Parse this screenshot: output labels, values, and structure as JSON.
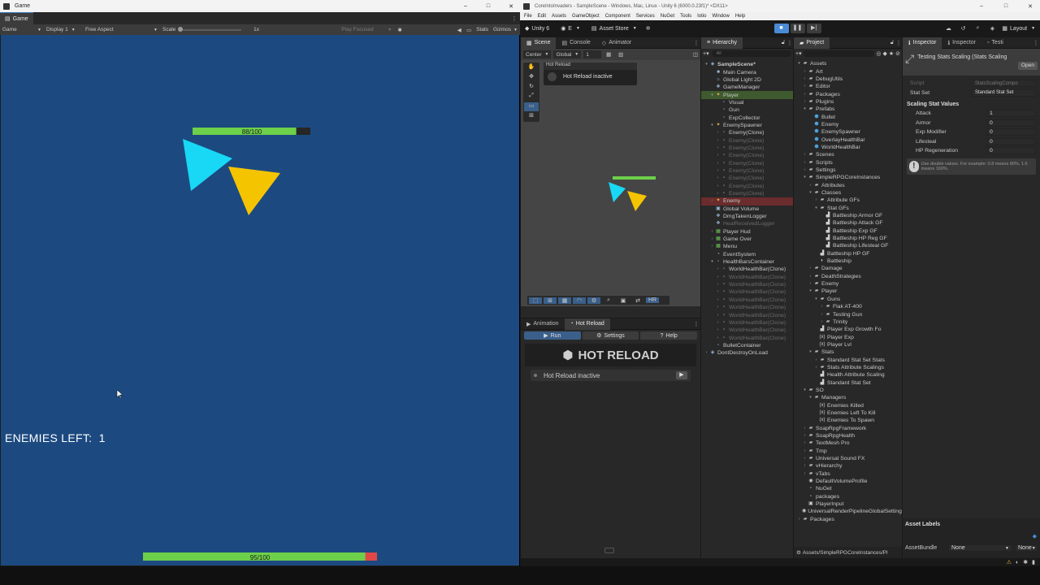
{
  "game_window": {
    "title": "Game",
    "tab": "Game",
    "toolbar": {
      "view": "Game",
      "display": "Display 1",
      "aspect": "Free Aspect",
      "scale_label": "Scale",
      "scale_value": "1x",
      "play_mode": "Play Focused",
      "stats": "Stats",
      "gizmos": "Gizmos"
    },
    "top_health_bar": {
      "text": "88/100",
      "fill": 0.88
    },
    "bottom_health_bar": {
      "text": "95/100",
      "fill": 0.95
    },
    "enemies_left_label": "ENEMIES LEFT:",
    "enemies_left_value": "1",
    "colors": {
      "bg": "#1c4a80",
      "cyan": "#18d8f5",
      "yellow": "#f5c400",
      "green": "#6dd04a",
      "red": "#e04848"
    }
  },
  "editor": {
    "title": "CoreIntoInvaders - SampleScene - Windows, Mac, Linux - Unity 6 (6000.0.23f1)* <DX11>",
    "menu": [
      "File",
      "Edit",
      "Assets",
      "GameObject",
      "Component",
      "Services",
      "NuGet",
      "Tools",
      "Iotio",
      "Window",
      "Help"
    ],
    "toolbar": {
      "unity": "Unity 6",
      "account": "E",
      "asset_store": "Asset Store",
      "layout": "Layout"
    },
    "scene_tabs": [
      "Scene",
      "Console",
      "Animator"
    ],
    "scene_toolbar": {
      "pivot": "Center",
      "space": "Global",
      "snap": "1"
    },
    "hot_reload_overlay": {
      "title": "Hot Reload",
      "status": "Hot Reload inactive"
    },
    "bottom_tabs": [
      "Animation",
      "Hot Reload"
    ],
    "hot_reload_panel": {
      "run": "Run",
      "settings": "Settings",
      "help": "Help",
      "logo": "HOT RELOAD",
      "status": "Hot Reload inactive"
    },
    "hierarchy": {
      "tab": "Hierarchy",
      "search_placeholder": "All",
      "items": [
        {
          "label": "SampleScene*",
          "indent": 0,
          "tri": "▾",
          "icon": "◈",
          "style": "bold"
        },
        {
          "label": "Main Camera",
          "indent": 1,
          "tri": "",
          "icon": "■",
          "style": ""
        },
        {
          "label": "Global Light 2D",
          "indent": 1,
          "tri": "",
          "icon": "☼",
          "style": ""
        },
        {
          "label": "GameManager",
          "indent": 1,
          "tri": "",
          "icon": "❖",
          "style": ""
        },
        {
          "label": "Player",
          "indent": 1,
          "tri": "▾",
          "icon": "✦",
          "style": "selg"
        },
        {
          "label": "Visual",
          "indent": 2,
          "tri": "",
          "icon": "▫",
          "style": ""
        },
        {
          "label": "Gun",
          "indent": 2,
          "tri": "",
          "icon": "▫",
          "style": ""
        },
        {
          "label": "ExpCollector",
          "indent": 2,
          "tri": "",
          "icon": "▫",
          "style": ""
        },
        {
          "label": "EnemySpawner",
          "indent": 1,
          "tri": "▾",
          "icon": "✦",
          "style": ""
        },
        {
          "label": "Enemy(Clone)",
          "indent": 2,
          "tri": "›",
          "icon": "▫",
          "style": ""
        },
        {
          "label": "Enemy(Clone)",
          "indent": 2,
          "tri": "›",
          "icon": "▫",
          "style": "dim"
        },
        {
          "label": "Enemy(Clone)",
          "indent": 2,
          "tri": "›",
          "icon": "▫",
          "style": "dim"
        },
        {
          "label": "Enemy(Clone)",
          "indent": 2,
          "tri": "›",
          "icon": "▫",
          "style": "dim"
        },
        {
          "label": "Enemy(Clone)",
          "indent": 2,
          "tri": "›",
          "icon": "▫",
          "style": "dim"
        },
        {
          "label": "Enemy(Clone)",
          "indent": 2,
          "tri": "›",
          "icon": "▫",
          "style": "dim"
        },
        {
          "label": "Enemy(Clone)",
          "indent": 2,
          "tri": "›",
          "icon": "▫",
          "style": "dim"
        },
        {
          "label": "Enemy(Clone)",
          "indent": 2,
          "tri": "›",
          "icon": "▫",
          "style": "dim"
        },
        {
          "label": "Enemy(Clone)",
          "indent": 2,
          "tri": "›",
          "icon": "▫",
          "style": "dim"
        },
        {
          "label": "Enemy",
          "indent": 1,
          "tri": "›",
          "icon": "✦",
          "style": "selr"
        },
        {
          "label": "Global Volume",
          "indent": 1,
          "tri": "",
          "icon": "▣",
          "style": ""
        },
        {
          "label": "DmgTakenLogger",
          "indent": 1,
          "tri": "",
          "icon": "❖",
          "style": ""
        },
        {
          "label": "HealReceivedLogger",
          "indent": 1,
          "tri": "",
          "icon": "❖",
          "style": "dim"
        },
        {
          "label": "Player Hud",
          "indent": 1,
          "tri": "›",
          "icon": "▦",
          "style": ""
        },
        {
          "label": "Game Over",
          "indent": 1,
          "tri": "›",
          "icon": "▦",
          "style": ""
        },
        {
          "label": "Menu",
          "indent": 1,
          "tri": "›",
          "icon": "▦",
          "style": ""
        },
        {
          "label": "EventSystem",
          "indent": 1,
          "tri": "",
          "icon": "◔",
          "style": ""
        },
        {
          "label": "HealthBarsContainer",
          "indent": 1,
          "tri": "▾",
          "icon": "▫",
          "style": ""
        },
        {
          "label": "WorldHealthBar(Clone)",
          "indent": 2,
          "tri": "›",
          "icon": "▫",
          "style": ""
        },
        {
          "label": "WorldHealthBar(Clone)",
          "indent": 2,
          "tri": "›",
          "icon": "▫",
          "style": "dim"
        },
        {
          "label": "WorldHealthBar(Clone)",
          "indent": 2,
          "tri": "›",
          "icon": "▫",
          "style": "dim"
        },
        {
          "label": "WorldHealthBar(Clone)",
          "indent": 2,
          "tri": "›",
          "icon": "▫",
          "style": "dim"
        },
        {
          "label": "WorldHealthBar(Clone)",
          "indent": 2,
          "tri": "›",
          "icon": "▫",
          "style": "dim"
        },
        {
          "label": "WorldHealthBar(Clone)",
          "indent": 2,
          "tri": "›",
          "icon": "▫",
          "style": "dim"
        },
        {
          "label": "WorldHealthBar(Clone)",
          "indent": 2,
          "tri": "›",
          "icon": "▫",
          "style": "dim"
        },
        {
          "label": "WorldHealthBar(Clone)",
          "indent": 2,
          "tri": "›",
          "icon": "▫",
          "style": "dim"
        },
        {
          "label": "WorldHealthBar(Clone)",
          "indent": 2,
          "tri": "›",
          "icon": "▫",
          "style": "dim"
        },
        {
          "label": "WorldHealthBar(Clone)",
          "indent": 2,
          "tri": "›",
          "icon": "▫",
          "style": "dim"
        },
        {
          "label": "BulletContainer",
          "indent": 1,
          "tri": "",
          "icon": "▫",
          "style": ""
        },
        {
          "label": "DontDestroyOnLoad",
          "indent": 0,
          "tri": "›",
          "icon": "◈",
          "style": ""
        }
      ]
    },
    "project": {
      "tab": "Project",
      "footer_path": "Assets/SimpleRPGCoreInstances/Pl",
      "items": [
        {
          "label": "Assets",
          "indent": 0,
          "tri": "▾",
          "icon": "▰"
        },
        {
          "label": "Art",
          "indent": 1,
          "tri": "›",
          "icon": "▰"
        },
        {
          "label": "DebugUtils",
          "indent": 1,
          "tri": "›",
          "icon": "▰"
        },
        {
          "label": "Editor",
          "indent": 1,
          "tri": "›",
          "icon": "▰"
        },
        {
          "label": "Packages",
          "indent": 1,
          "tri": "›",
          "icon": "▰"
        },
        {
          "label": "Plugins",
          "indent": 1,
          "tri": "›",
          "icon": "▰"
        },
        {
          "label": "Prefabs",
          "indent": 1,
          "tri": "▾",
          "icon": "▰"
        },
        {
          "label": "Bullet",
          "indent": 2,
          "tri": "",
          "icon": "⬢"
        },
        {
          "label": "Enemy",
          "indent": 2,
          "tri": "",
          "icon": "⬢"
        },
        {
          "label": "EnemySpawner",
          "indent": 2,
          "tri": "",
          "icon": "⬢"
        },
        {
          "label": "OverlayHealthBar",
          "indent": 2,
          "tri": "",
          "icon": "⬢"
        },
        {
          "label": "WorldHealthBar",
          "indent": 2,
          "tri": "",
          "icon": "⬢"
        },
        {
          "label": "Scenes",
          "indent": 1,
          "tri": "›",
          "icon": "▰"
        },
        {
          "label": "Scripts",
          "indent": 1,
          "tri": "›",
          "icon": "▰"
        },
        {
          "label": "Settings",
          "indent": 1,
          "tri": "›",
          "icon": "▰"
        },
        {
          "label": "SimpleRPGCoreInstances",
          "indent": 1,
          "tri": "▾",
          "icon": "▰"
        },
        {
          "label": "Attributes",
          "indent": 2,
          "tri": "›",
          "icon": "▰"
        },
        {
          "label": "Classes",
          "indent": 2,
          "tri": "▾",
          "icon": "▰"
        },
        {
          "label": "Attribute GFs",
          "indent": 3,
          "tri": "›",
          "icon": "▰"
        },
        {
          "label": "Stat GFs",
          "indent": 3,
          "tri": "▾",
          "icon": "▰"
        },
        {
          "label": "Battleship Armor GF",
          "indent": 4,
          "tri": "",
          "icon": "▟"
        },
        {
          "label": "Battleship Attack GF",
          "indent": 4,
          "tri": "",
          "icon": "▟"
        },
        {
          "label": "Battleship Exp  GF",
          "indent": 4,
          "tri": "",
          "icon": "▟"
        },
        {
          "label": "Battleship HP Reg GF",
          "indent": 4,
          "tri": "",
          "icon": "▟"
        },
        {
          "label": "Battleship Lifesteal GF",
          "indent": 4,
          "tri": "",
          "icon": "▟"
        },
        {
          "label": "Battleship HP GF",
          "indent": 3,
          "tri": "",
          "icon": "▟"
        },
        {
          "label": "Battleship",
          "indent": 3,
          "tri": "",
          "icon": "◐"
        },
        {
          "label": "Damage",
          "indent": 2,
          "tri": "›",
          "icon": "▰"
        },
        {
          "label": "DeathStrategies",
          "indent": 2,
          "tri": "›",
          "icon": "▰"
        },
        {
          "label": "Enemy",
          "indent": 2,
          "tri": "›",
          "icon": "▰"
        },
        {
          "label": "Player",
          "indent": 2,
          "tri": "▾",
          "icon": "▰"
        },
        {
          "label": "Guns",
          "indent": 3,
          "tri": "▾",
          "icon": "▰"
        },
        {
          "label": "Flak AT-400",
          "indent": 4,
          "tri": "›",
          "icon": "▰"
        },
        {
          "label": "Testing Gun",
          "indent": 4,
          "tri": "›",
          "icon": "▰"
        },
        {
          "label": "Trinity",
          "indent": 4,
          "tri": "›",
          "icon": "▰"
        },
        {
          "label": "Player Exp Growth Fo",
          "indent": 3,
          "tri": "",
          "icon": "▟"
        },
        {
          "label": "Player Exp",
          "indent": 3,
          "tri": "",
          "icon": "(x)"
        },
        {
          "label": "Player Lvl",
          "indent": 3,
          "tri": "",
          "icon": "(x)"
        },
        {
          "label": "Stats",
          "indent": 2,
          "tri": "▾",
          "icon": "▰"
        },
        {
          "label": "Standard Stat Set Stats",
          "indent": 3,
          "tri": "›",
          "icon": "▰"
        },
        {
          "label": "Stats Attribute Scalings",
          "indent": 3,
          "tri": "›",
          "icon": "▰"
        },
        {
          "label": "Health Attribute Scaling",
          "indent": 3,
          "tri": "",
          "icon": "▟"
        },
        {
          "label": "Standard Stat Set",
          "indent": 3,
          "tri": "",
          "icon": "▟"
        },
        {
          "label": "SO",
          "indent": 1,
          "tri": "▾",
          "icon": "▰"
        },
        {
          "label": "Managers",
          "indent": 2,
          "tri": "▾",
          "icon": "▰"
        },
        {
          "label": "Enemies Killed",
          "indent": 3,
          "tri": "",
          "icon": "(x)"
        },
        {
          "label": "Enemies Left To Kill",
          "indent": 3,
          "tri": "",
          "icon": "(x)"
        },
        {
          "label": "Enemies To Spawn",
          "indent": 3,
          "tri": "",
          "icon": "(x)"
        },
        {
          "label": "SoapRpgFramework",
          "indent": 1,
          "tri": "›",
          "icon": "▰"
        },
        {
          "label": "SoapRpgHealth",
          "indent": 1,
          "tri": "›",
          "icon": "▰"
        },
        {
          "label": "TextMesh Pro",
          "indent": 1,
          "tri": "›",
          "icon": "▰"
        },
        {
          "label": "Tmp",
          "indent": 1,
          "tri": "›",
          "icon": "▰"
        },
        {
          "label": "Universal Sound FX",
          "indent": 1,
          "tri": "›",
          "icon": "▰"
        },
        {
          "label": "vHierarchy",
          "indent": 1,
          "tri": "›",
          "icon": "▰"
        },
        {
          "label": "vTabs",
          "indent": 1,
          "tri": "›",
          "icon": "▰"
        },
        {
          "label": "DefaultVolumeProfile",
          "indent": 1,
          "tri": "",
          "icon": "◉"
        },
        {
          "label": "NuGet",
          "indent": 1,
          "tri": "",
          "icon": "▫"
        },
        {
          "label": "packages",
          "indent": 1,
          "tri": "",
          "icon": "▫"
        },
        {
          "label": "PlayerInput",
          "indent": 1,
          "tri": "",
          "icon": "▣"
        },
        {
          "label": "UniversalRenderPipelineGlobalSettings",
          "indent": 1,
          "tri": "",
          "icon": "◉"
        },
        {
          "label": "Packages",
          "indent": 0,
          "tri": "›",
          "icon": "▰"
        }
      ]
    },
    "inspector": {
      "tabs": [
        "Inspector",
        "Inspector",
        "Testi"
      ],
      "header": "Testing Stats Scaling (Stats Scaling",
      "open": "Open",
      "script_label": "Script",
      "script_value": "StatsScalingCompo",
      "stat_set_label": "Stat Set",
      "stat_set_value": "Standard Stat Set",
      "section": "Scaling Stat Values",
      "fields": [
        {
          "label": "Attack",
          "value": "1"
        },
        {
          "label": "Armor",
          "value": "0"
        },
        {
          "label": "Exp Modifier",
          "value": "0"
        },
        {
          "label": "Lifesteal",
          "value": "0"
        },
        {
          "label": "HP Regeneration",
          "value": "0"
        }
      ],
      "info": "Use double values. For example: 0.8 means 80%, 1.6 means 160%.",
      "asset_labels": "Asset Labels",
      "asset_bundle_label": "AssetBundle",
      "asset_bundle_value": "None",
      "asset_variant_value": "None"
    }
  }
}
